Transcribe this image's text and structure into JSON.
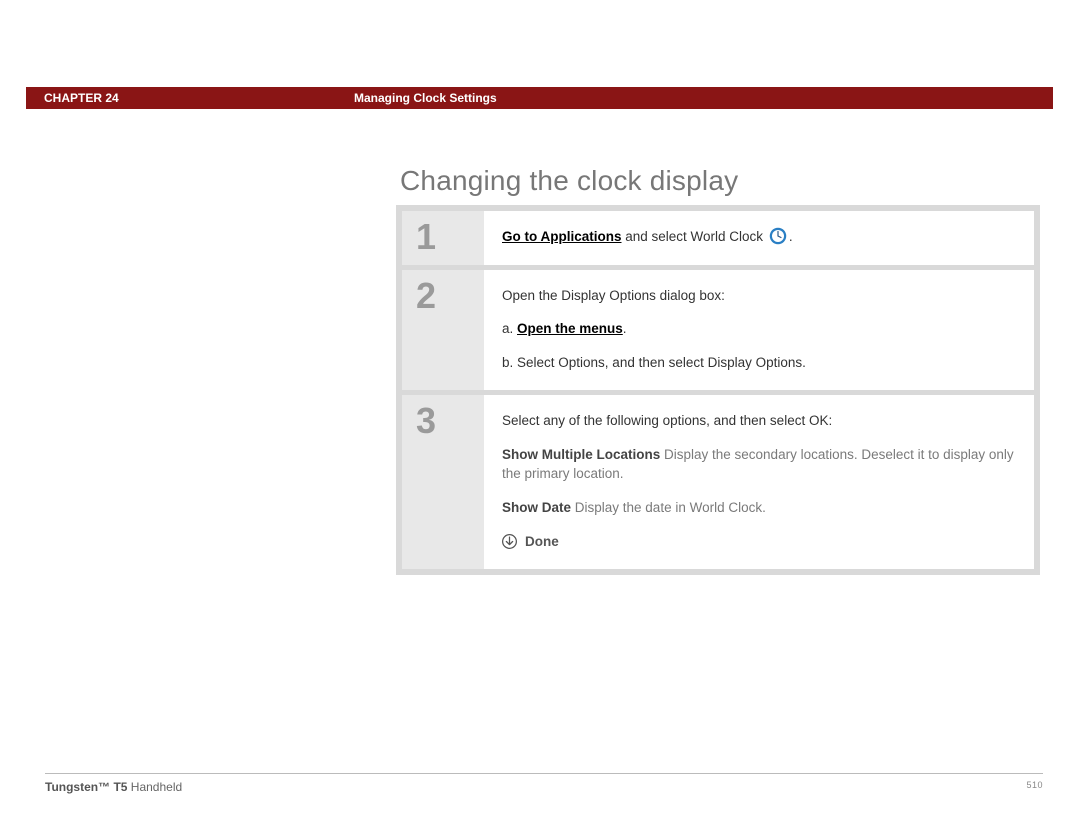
{
  "header": {
    "chapter": "CHAPTER 24",
    "title": "Managing Clock Settings"
  },
  "page_title": "Changing the clock display",
  "steps": [
    {
      "num": "1",
      "lines": [
        {
          "parts": [
            {
              "type": "link",
              "text": "Go to Applications"
            },
            {
              "type": "text",
              "text": " and select World Clock "
            },
            {
              "type": "icon",
              "name": "world-clock-icon"
            },
            {
              "type": "text",
              "text": "."
            }
          ]
        }
      ]
    },
    {
      "num": "2",
      "lines": [
        {
          "parts": [
            {
              "type": "text",
              "text": "Open the Display Options dialog box:"
            }
          ]
        },
        {
          "parts": [
            {
              "type": "text",
              "text": "a.  "
            },
            {
              "type": "link",
              "text": "Open the menus"
            },
            {
              "type": "text",
              "text": "."
            }
          ]
        },
        {
          "parts": [
            {
              "type": "text",
              "text": "b.  Select Options, and then select Display Options."
            }
          ]
        }
      ]
    },
    {
      "num": "3",
      "lines": [
        {
          "parts": [
            {
              "type": "text",
              "text": "Select any of the following options, and then select OK:"
            }
          ]
        },
        {
          "parts": [
            {
              "type": "optlabel",
              "text": "Show Multiple Locations"
            },
            {
              "type": "opttext",
              "text": "    Display the secondary locations. Deselect it to display only the primary location."
            }
          ]
        },
        {
          "parts": [
            {
              "type": "optlabel",
              "text": "Show Date"
            },
            {
              "type": "opttext",
              "text": "    Display the date in World Clock."
            }
          ]
        },
        {
          "done": true,
          "text": "Done"
        }
      ]
    }
  ],
  "footer": {
    "product_bold": "Tungsten™ T5",
    "product_rest": " Handheld",
    "page_number": "510"
  }
}
